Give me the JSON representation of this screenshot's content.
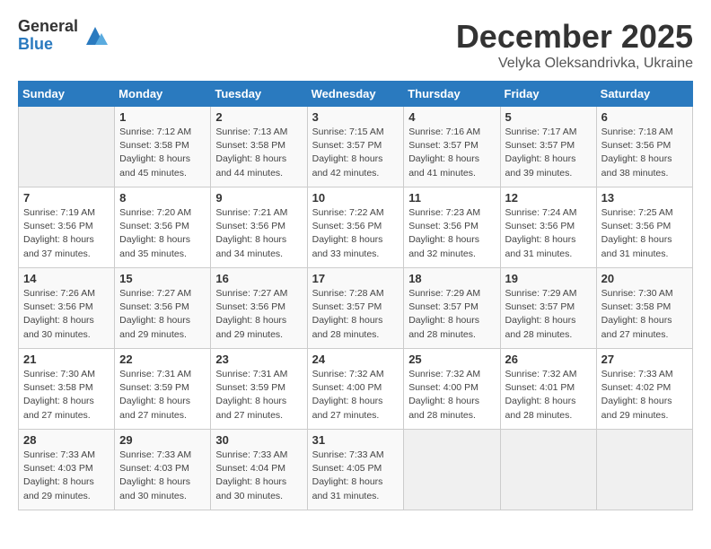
{
  "logo": {
    "general": "General",
    "blue": "Blue"
  },
  "title": "December 2025",
  "subtitle": "Velyka Oleksandrivka, Ukraine",
  "days_of_week": [
    "Sunday",
    "Monday",
    "Tuesday",
    "Wednesday",
    "Thursday",
    "Friday",
    "Saturday"
  ],
  "weeks": [
    [
      {
        "day": "",
        "info": ""
      },
      {
        "day": "1",
        "info": "Sunrise: 7:12 AM\nSunset: 3:58 PM\nDaylight: 8 hours\nand 45 minutes."
      },
      {
        "day": "2",
        "info": "Sunrise: 7:13 AM\nSunset: 3:58 PM\nDaylight: 8 hours\nand 44 minutes."
      },
      {
        "day": "3",
        "info": "Sunrise: 7:15 AM\nSunset: 3:57 PM\nDaylight: 8 hours\nand 42 minutes."
      },
      {
        "day": "4",
        "info": "Sunrise: 7:16 AM\nSunset: 3:57 PM\nDaylight: 8 hours\nand 41 minutes."
      },
      {
        "day": "5",
        "info": "Sunrise: 7:17 AM\nSunset: 3:57 PM\nDaylight: 8 hours\nand 39 minutes."
      },
      {
        "day": "6",
        "info": "Sunrise: 7:18 AM\nSunset: 3:56 PM\nDaylight: 8 hours\nand 38 minutes."
      }
    ],
    [
      {
        "day": "7",
        "info": "Sunrise: 7:19 AM\nSunset: 3:56 PM\nDaylight: 8 hours\nand 37 minutes."
      },
      {
        "day": "8",
        "info": "Sunrise: 7:20 AM\nSunset: 3:56 PM\nDaylight: 8 hours\nand 35 minutes."
      },
      {
        "day": "9",
        "info": "Sunrise: 7:21 AM\nSunset: 3:56 PM\nDaylight: 8 hours\nand 34 minutes."
      },
      {
        "day": "10",
        "info": "Sunrise: 7:22 AM\nSunset: 3:56 PM\nDaylight: 8 hours\nand 33 minutes."
      },
      {
        "day": "11",
        "info": "Sunrise: 7:23 AM\nSunset: 3:56 PM\nDaylight: 8 hours\nand 32 minutes."
      },
      {
        "day": "12",
        "info": "Sunrise: 7:24 AM\nSunset: 3:56 PM\nDaylight: 8 hours\nand 31 minutes."
      },
      {
        "day": "13",
        "info": "Sunrise: 7:25 AM\nSunset: 3:56 PM\nDaylight: 8 hours\nand 31 minutes."
      }
    ],
    [
      {
        "day": "14",
        "info": "Sunrise: 7:26 AM\nSunset: 3:56 PM\nDaylight: 8 hours\nand 30 minutes."
      },
      {
        "day": "15",
        "info": "Sunrise: 7:27 AM\nSunset: 3:56 PM\nDaylight: 8 hours\nand 29 minutes."
      },
      {
        "day": "16",
        "info": "Sunrise: 7:27 AM\nSunset: 3:56 PM\nDaylight: 8 hours\nand 29 minutes."
      },
      {
        "day": "17",
        "info": "Sunrise: 7:28 AM\nSunset: 3:57 PM\nDaylight: 8 hours\nand 28 minutes."
      },
      {
        "day": "18",
        "info": "Sunrise: 7:29 AM\nSunset: 3:57 PM\nDaylight: 8 hours\nand 28 minutes."
      },
      {
        "day": "19",
        "info": "Sunrise: 7:29 AM\nSunset: 3:57 PM\nDaylight: 8 hours\nand 28 minutes."
      },
      {
        "day": "20",
        "info": "Sunrise: 7:30 AM\nSunset: 3:58 PM\nDaylight: 8 hours\nand 27 minutes."
      }
    ],
    [
      {
        "day": "21",
        "info": "Sunrise: 7:30 AM\nSunset: 3:58 PM\nDaylight: 8 hours\nand 27 minutes."
      },
      {
        "day": "22",
        "info": "Sunrise: 7:31 AM\nSunset: 3:59 PM\nDaylight: 8 hours\nand 27 minutes."
      },
      {
        "day": "23",
        "info": "Sunrise: 7:31 AM\nSunset: 3:59 PM\nDaylight: 8 hours\nand 27 minutes."
      },
      {
        "day": "24",
        "info": "Sunrise: 7:32 AM\nSunset: 4:00 PM\nDaylight: 8 hours\nand 27 minutes."
      },
      {
        "day": "25",
        "info": "Sunrise: 7:32 AM\nSunset: 4:00 PM\nDaylight: 8 hours\nand 28 minutes."
      },
      {
        "day": "26",
        "info": "Sunrise: 7:32 AM\nSunset: 4:01 PM\nDaylight: 8 hours\nand 28 minutes."
      },
      {
        "day": "27",
        "info": "Sunrise: 7:33 AM\nSunset: 4:02 PM\nDaylight: 8 hours\nand 29 minutes."
      }
    ],
    [
      {
        "day": "28",
        "info": "Sunrise: 7:33 AM\nSunset: 4:03 PM\nDaylight: 8 hours\nand 29 minutes."
      },
      {
        "day": "29",
        "info": "Sunrise: 7:33 AM\nSunset: 4:03 PM\nDaylight: 8 hours\nand 30 minutes."
      },
      {
        "day": "30",
        "info": "Sunrise: 7:33 AM\nSunset: 4:04 PM\nDaylight: 8 hours\nand 30 minutes."
      },
      {
        "day": "31",
        "info": "Sunrise: 7:33 AM\nSunset: 4:05 PM\nDaylight: 8 hours\nand 31 minutes."
      },
      {
        "day": "",
        "info": ""
      },
      {
        "day": "",
        "info": ""
      },
      {
        "day": "",
        "info": ""
      }
    ]
  ]
}
